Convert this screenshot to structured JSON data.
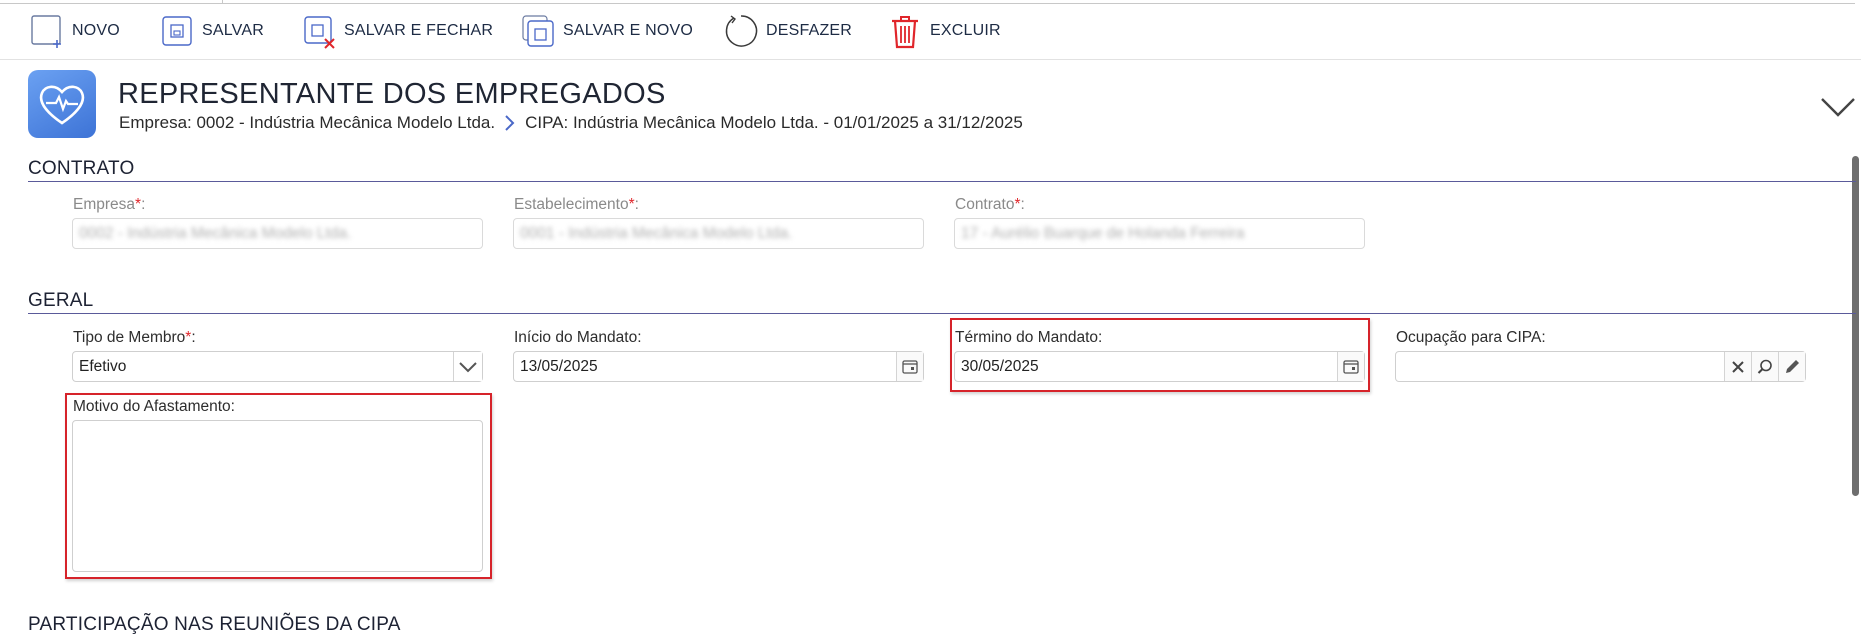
{
  "toolbar": {
    "novo": "NOVO",
    "salvar": "SALVAR",
    "salvar_fechar": "SALVAR E FECHAR",
    "salvar_novo": "SALVAR E NOVO",
    "desfazer": "DESFAZER",
    "excluir": "EXCLUIR"
  },
  "header": {
    "title": "REPRESENTANTE DOS EMPREGADOS",
    "breadcrumb_empresa": "Empresa: 0002 - Indústria Mecânica Modelo Ltda.",
    "breadcrumb_cipa": "CIPA: Indústria Mecânica Modelo Ltda. - 01/01/2025 a 31/12/2025"
  },
  "contrato": {
    "section_title": "CONTRATO",
    "empresa_label": "Empresa",
    "empresa_value": "0002 - Indústria Mecânica Modelo Ltda.",
    "estabelecimento_label": "Estabelecimento",
    "estabelecimento_value": "0001 - Indústria Mecânica Modelo Ltda.",
    "contrato_label": "Contrato",
    "contrato_value": "17 - Aurélio Buarque de Holanda Ferreira",
    "required_mark": "*",
    "colon": ":"
  },
  "geral": {
    "section_title": "GERAL",
    "tipo_membro_label": "Tipo de Membro",
    "tipo_membro_value": "Efetivo",
    "inicio_label": "Início do Mandato:",
    "inicio_value": "13/05/2025",
    "termino_label": "Término do Mandato:",
    "termino_value": "30/05/2025",
    "ocupacao_label": "Ocupação para CIPA:",
    "ocupacao_value": "",
    "motivo_label": "Motivo do Afastamento:",
    "motivo_value": ""
  },
  "next_section_title": "PARTICIPAÇÃO NAS REUNIÕES DA CIPA",
  "colors": {
    "accent": "#3d73d6",
    "required": "#e0262b",
    "highlight": "#d6232a",
    "section_line": "#5a5a9a"
  }
}
